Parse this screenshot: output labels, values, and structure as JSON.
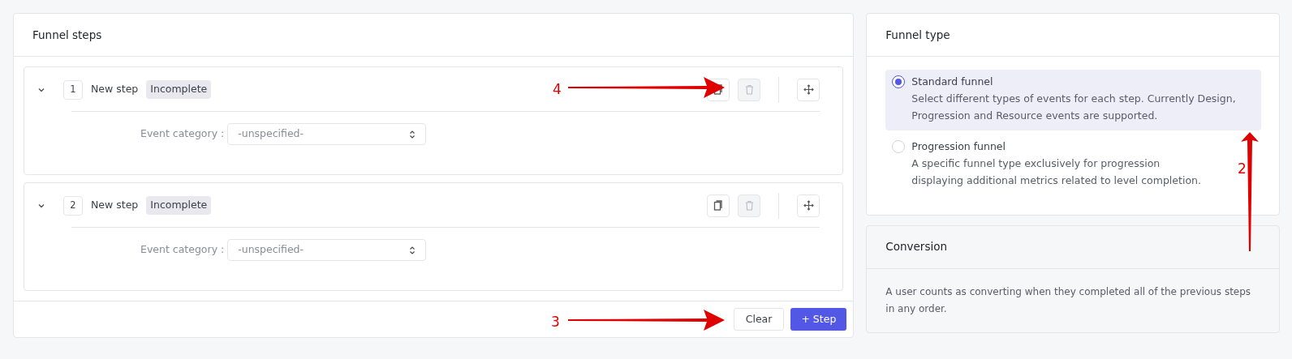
{
  "funnel_steps": {
    "title": "Funnel steps",
    "steps": [
      {
        "number": "1",
        "name": "New step",
        "status": "Incomplete",
        "expanded": true,
        "field_label": "Event category :",
        "field_value": "-unspecified-",
        "delete_disabled": true
      },
      {
        "number": "2",
        "name": "New step",
        "status": "Incomplete",
        "expanded": true,
        "field_label": "Event category :",
        "field_value": "-unspecified-",
        "delete_disabled": true
      }
    ],
    "buttons": [
      {
        "label": "Clear",
        "kind": "secondary"
      },
      {
        "label": "Step",
        "kind": "primary",
        "icon": "+"
      }
    ]
  },
  "funnel_type": {
    "title": "Funnel type",
    "options": [
      {
        "label": "Standard funnel",
        "description": "Select different types of events for each step. Currently Design, Progression and Resource events are supported.",
        "selected": true
      },
      {
        "label": "Progression funnel",
        "description": "A specific funnel type exclusively for progression displaying additional metrics related to level completion.",
        "selected": false
      }
    ]
  },
  "conversion": {
    "title": "Conversion",
    "text": "A user counts as converting when they completed all of the previous steps in any order."
  },
  "annotations": [
    {
      "label": "4",
      "kind": "horizontal"
    },
    {
      "label": "3",
      "kind": "horizontal"
    },
    {
      "label": "2",
      "kind": "vertical"
    }
  ]
}
